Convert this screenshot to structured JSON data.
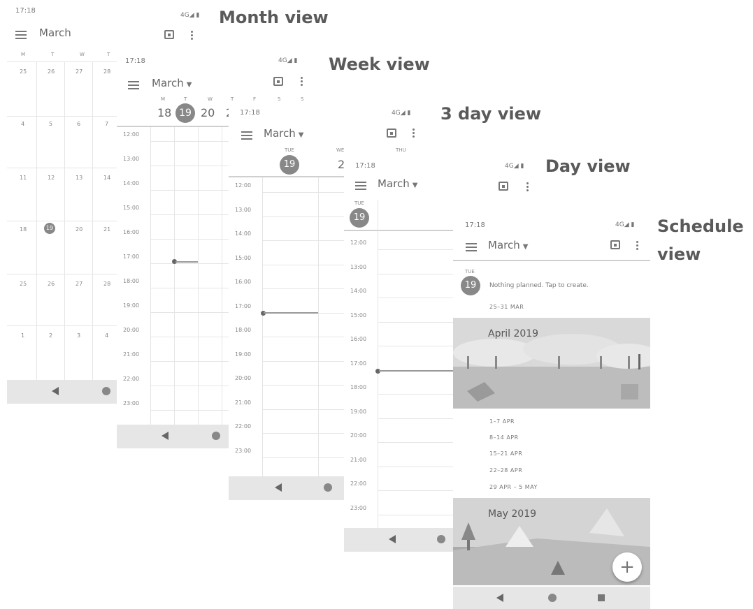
{
  "labels": {
    "month": "Month view",
    "week": "Week view",
    "three": "3 day view",
    "day": "Day view",
    "schedule_line1": "Schedule",
    "schedule_line2": "view"
  },
  "status": {
    "time": "17:18",
    "signal": "4G◢ ▮"
  },
  "month_title": "March",
  "month_view": {
    "weekdays": [
      "M",
      "T",
      "W",
      "T"
    ],
    "weeks": [
      [
        "25",
        "26",
        "27",
        "28"
      ],
      [
        "4",
        "5",
        "6",
        "7"
      ],
      [
        "11",
        "12",
        "13",
        "14"
      ],
      [
        "18",
        "19",
        "20",
        "21"
      ],
      [
        "25",
        "26",
        "27",
        "28"
      ],
      [
        "1",
        "2",
        "3",
        "4"
      ]
    ]
  },
  "week_view": {
    "weekdays": [
      "M",
      "T",
      "W",
      "T",
      "F",
      "S",
      "S"
    ],
    "dates": [
      "18",
      "19",
      "20",
      "2"
    ],
    "hours": [
      "12:00",
      "13:00",
      "14:00",
      "15:00",
      "16:00",
      "17:00",
      "18:00",
      "19:00",
      "20:00",
      "21:00",
      "22:00",
      "23:00"
    ]
  },
  "three_day_view": {
    "days": [
      "TUE",
      "WED",
      "THU"
    ],
    "today": "19",
    "next": "2",
    "hours": [
      "12:00",
      "13:00",
      "14:00",
      "15:00",
      "16:00",
      "17:00",
      "18:00",
      "19:00",
      "20:00",
      "21:00",
      "22:00",
      "23:00"
    ]
  },
  "day_view": {
    "day": "TUE",
    "today": "19",
    "hours": [
      "12:00",
      "13:00",
      "14:00",
      "15:00",
      "16:00",
      "17:00",
      "18:00",
      "19:00",
      "20:00",
      "21:00",
      "22:00",
      "23:00"
    ]
  },
  "schedule_view": {
    "day": "TUE",
    "today": "19",
    "nothing_planned": "Nothing planned. Tap to create.",
    "week_range": "25–31 MAR",
    "april_banner": "April 2019",
    "april_weeks": [
      "1–7 APR",
      "8–14 APR",
      "15–21 APR",
      "22–28 APR",
      "29 APR – 5 MAY"
    ],
    "may_banner": "May 2019",
    "fab_label": "+"
  }
}
